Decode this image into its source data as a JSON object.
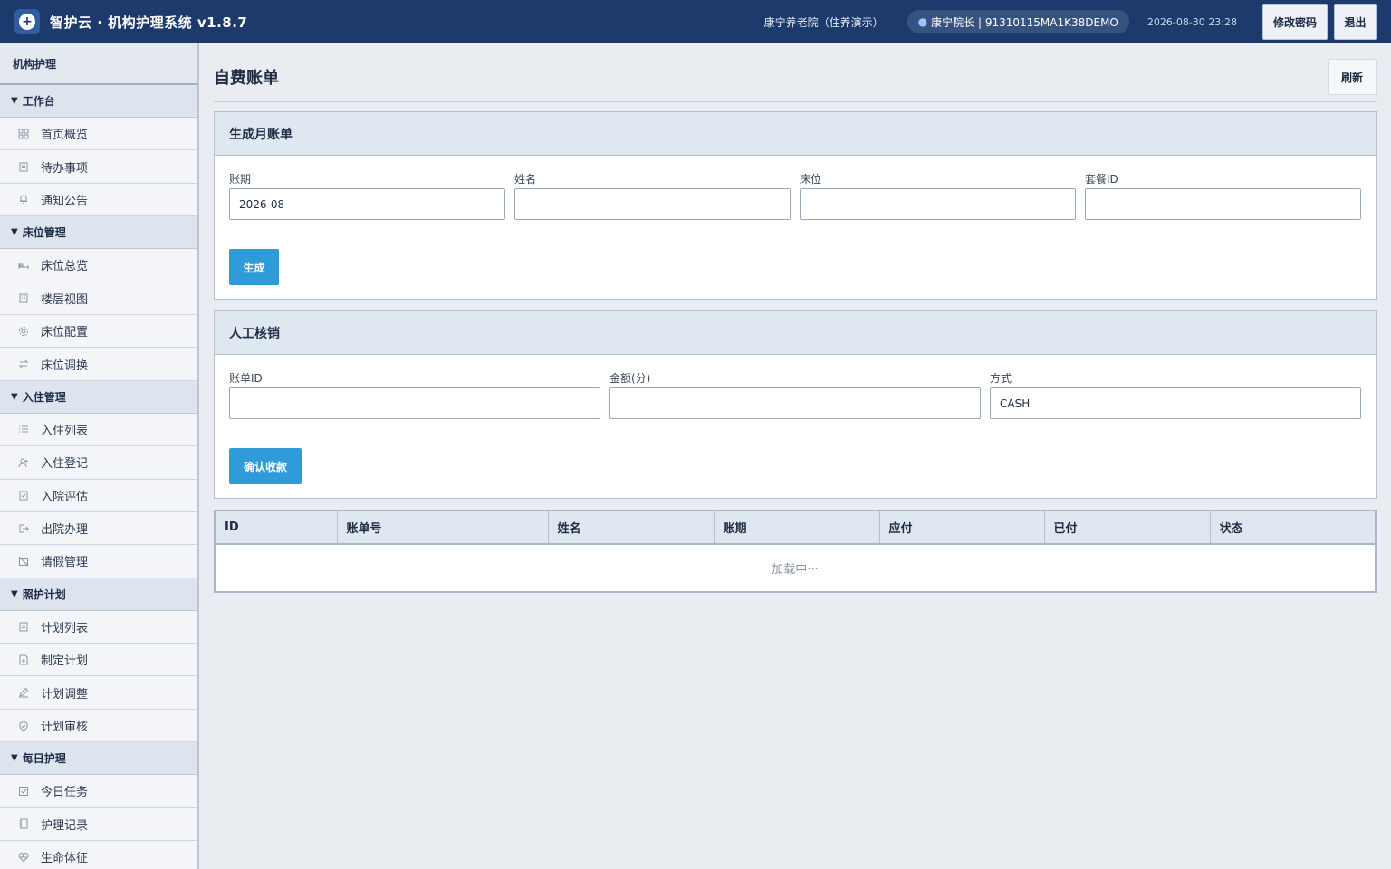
{
  "topbar": {
    "app_title": "智护云 · 机构护理系统 v1.8.7",
    "org": "康宁养老院（住养演示）",
    "user": "康宁院长 | 91310115MA1K38DEMO",
    "datetime": "2026-08-30 23:28",
    "change_password": "修改密码",
    "logout": "退出"
  },
  "sidebar": {
    "title": "机构护理",
    "groups": [
      {
        "label": "工作台",
        "items": [
          {
            "label": "首页概览",
            "icon": "grid-icon"
          },
          {
            "label": "待办事项",
            "icon": "clipboard-icon"
          },
          {
            "label": "通知公告",
            "icon": "bell-icon"
          }
        ]
      },
      {
        "label": "床位管理",
        "items": [
          {
            "label": "床位总览",
            "icon": "bed-icon"
          },
          {
            "label": "楼层视图",
            "icon": "building-icon"
          },
          {
            "label": "床位配置",
            "icon": "gear-icon"
          },
          {
            "label": "床位调换",
            "icon": "swap-icon"
          }
        ]
      },
      {
        "label": "入住管理",
        "items": [
          {
            "label": "入住列表",
            "icon": "list-icon"
          },
          {
            "label": "入住登记",
            "icon": "user-plus-icon"
          },
          {
            "label": "入院评估",
            "icon": "clipboard-check-icon"
          },
          {
            "label": "出院办理",
            "icon": "exit-icon"
          },
          {
            "label": "请假管理",
            "icon": "calendar-off-icon"
          }
        ]
      },
      {
        "label": "照护计划",
        "items": [
          {
            "label": "计划列表",
            "icon": "clipboard-icon"
          },
          {
            "label": "制定计划",
            "icon": "file-plus-icon"
          },
          {
            "label": "计划调整",
            "icon": "pencil-icon"
          },
          {
            "label": "计划审核",
            "icon": "shield-check-icon"
          }
        ]
      },
      {
        "label": "每日护理",
        "items": [
          {
            "label": "今日任务",
            "icon": "checkbox-icon"
          },
          {
            "label": "护理记录",
            "icon": "notebook-icon"
          },
          {
            "label": "生命体征",
            "icon": "heartbeat-icon"
          }
        ]
      }
    ]
  },
  "page": {
    "title": "自费账单",
    "refresh": "刷新"
  },
  "generate_card": {
    "title": "生成月账单",
    "fields": [
      {
        "label": "账期",
        "value": "2026-08"
      },
      {
        "label": "姓名",
        "value": ""
      },
      {
        "label": "床位",
        "value": ""
      },
      {
        "label": "套餐ID",
        "value": ""
      }
    ],
    "button": "生成"
  },
  "writeoff_card": {
    "title": "人工核销",
    "fields": [
      {
        "label": "账单ID",
        "value": ""
      },
      {
        "label": "金额(分)",
        "value": ""
      },
      {
        "label": "方式",
        "value": "CASH"
      }
    ],
    "button": "确认收款"
  },
  "table": {
    "columns": [
      "ID",
      "账单号",
      "姓名",
      "账期",
      "应付",
      "已付",
      "状态"
    ],
    "empty_text": "加载中···"
  }
}
